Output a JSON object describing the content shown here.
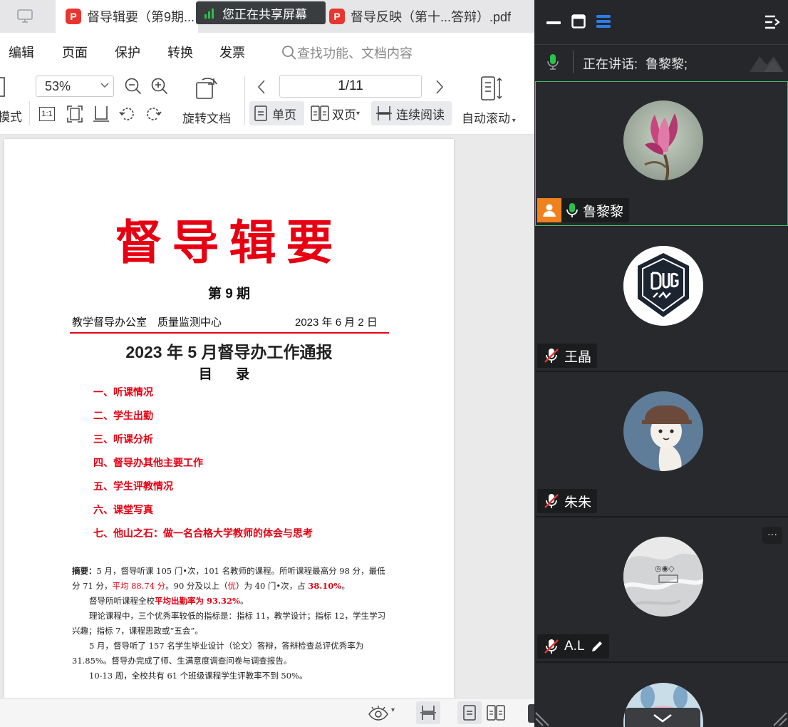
{
  "tabs": {
    "doc1": "督导辑要（第9期...",
    "doc2": "督导反映（第十...答辩）.pdf",
    "pdf_badge": "P"
  },
  "share_banner": {
    "label": "您正在共享屏幕"
  },
  "menu": {
    "edit": "编辑",
    "page": "页面",
    "protect": "保护",
    "convert": "转换",
    "publish": "发票",
    "search_placeholder": "查找功能、文档内容"
  },
  "toolbar": {
    "mode_label": "模式",
    "zoom_value": "53%",
    "actual_size": "1:1",
    "rotate_doc": "旋转文档",
    "page_value": "1/11",
    "single_page": "单页",
    "double_page": "双页",
    "continuous": "连续阅读",
    "auto_scroll": "自动滚动"
  },
  "document": {
    "title": "督导辑要",
    "issue": "第 9 期",
    "org": "教学督导办公室　质量监测中心",
    "date": "2023 年 6 月 2 日",
    "heading": "2023 年 5 月督导办工作通报",
    "toc_title": "目 录",
    "toc": [
      "一、听课情况",
      "二、学生出勤",
      "三、听课分析",
      "四、督导办其他主要工作",
      "五、学生评教情况",
      "六、课堂写真",
      "七、他山之石：做一名合格大学教师的体会与思考"
    ],
    "abstract": {
      "label": "摘要：",
      "p1a": "5 月，督导听课 105 门•次，101 名教师的课程。所听课程最高分 98 分，",
      "p1b": "最低分 71 分，",
      "p1c": "平均 88.74 分",
      "p1d": "。90 分及以上（",
      "p1e": "优",
      "p1f": "）为 40 门•次，占 ",
      "p1g": "38.10%",
      "p1h": "。",
      "p2a": "督导所听课程全校",
      "p2b": "平均出勤率为 93.32%",
      "p2c": "。",
      "p3": "理论课程中，三个优秀率较低的指标是：指标 11，教学设计；指标 12，学生学习兴趣；指标 7，课程思政或“五会”。",
      "p4": "5 月，督导听了 157 名学生毕业设计（论文）答辩，答辩检查总评优秀率为 31.85%。督导办完成了师、生满意度调查问卷与调查报告。",
      "p5": "10-13 周，全校共有 61 个班级课程学生评教率不到 50%。"
    }
  },
  "meeting": {
    "speaking_label": "正在讲话:",
    "speaking_name": "鲁黎黎;",
    "participants": [
      {
        "name": "鲁黎黎",
        "muted": false
      },
      {
        "name": "王晶",
        "muted": true
      },
      {
        "name": "朱朱",
        "muted": true
      },
      {
        "name": "A.L",
        "muted": true
      }
    ],
    "more_label": "···",
    "colors": {
      "panel_bg": "#25272a",
      "active_border": "#3fbf6c",
      "mic_green": "#29c24a",
      "badge_orange": "#f0821e",
      "toolbar_blue": "#2b7de9"
    }
  }
}
